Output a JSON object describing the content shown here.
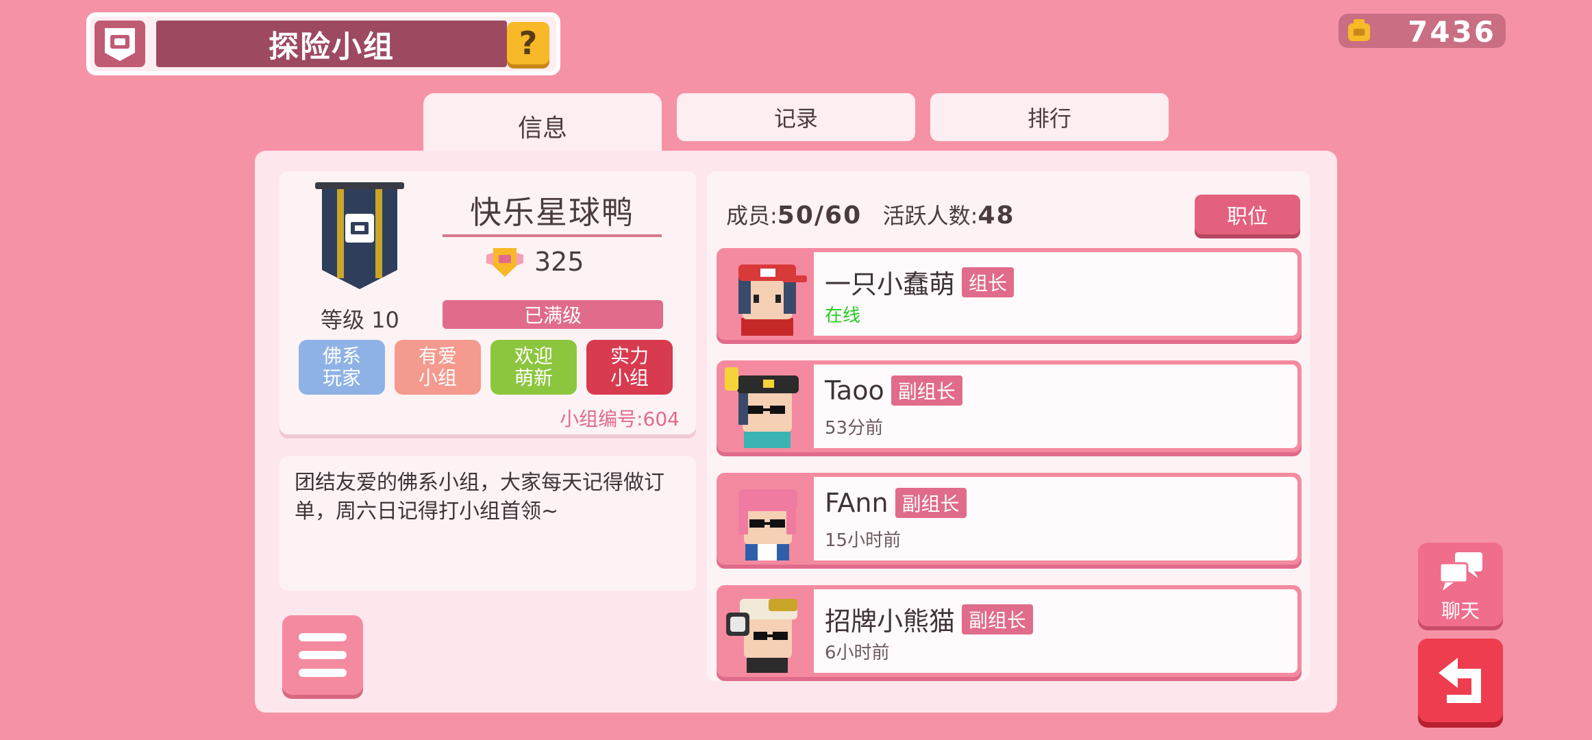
{
  "header": {
    "title": "探险小组",
    "help_label": "?",
    "currency_amount": "7436"
  },
  "tabs": [
    {
      "label": "信息",
      "active": true
    },
    {
      "label": "记录",
      "active": false
    },
    {
      "label": "排行",
      "active": false
    }
  ],
  "group": {
    "name": "快乐星球鸭",
    "score": "325",
    "level_label": "等级 10",
    "max_level_label": "已满级",
    "tags": [
      {
        "text": "佛系玩家",
        "color": "#8fb2e6"
      },
      {
        "text": "有爱小组",
        "color": "#f49a8e"
      },
      {
        "text": "欢迎萌新",
        "color": "#8cc63e"
      },
      {
        "text": "实力小组",
        "color": "#d83a4f"
      }
    ],
    "group_number": "小组编号:604",
    "description": "团结友爱的佛系小组，大家每天记得做订单，周六日记得打小组首领~"
  },
  "members_panel": {
    "members_label": "成员:",
    "members_count": "50/60",
    "active_label": "活跃人数:",
    "active_count": "48",
    "role_button": "职位",
    "members": [
      {
        "name": "一只小蠢萌",
        "role": "组长",
        "status": "在线",
        "online": true
      },
      {
        "name": "Taoo",
        "role": "副组长",
        "status": "53分前",
        "online": false
      },
      {
        "name": "FAnn",
        "role": "副组长",
        "status": "15小时前",
        "online": false
      },
      {
        "name": "招牌小熊猫",
        "role": "副组长",
        "status": "6小时前",
        "online": false
      }
    ]
  },
  "side_buttons": {
    "chat_label": "聊天"
  },
  "colors": {
    "background": "#f692a6",
    "accent": "#e06b8a",
    "online": "#22cc22"
  }
}
